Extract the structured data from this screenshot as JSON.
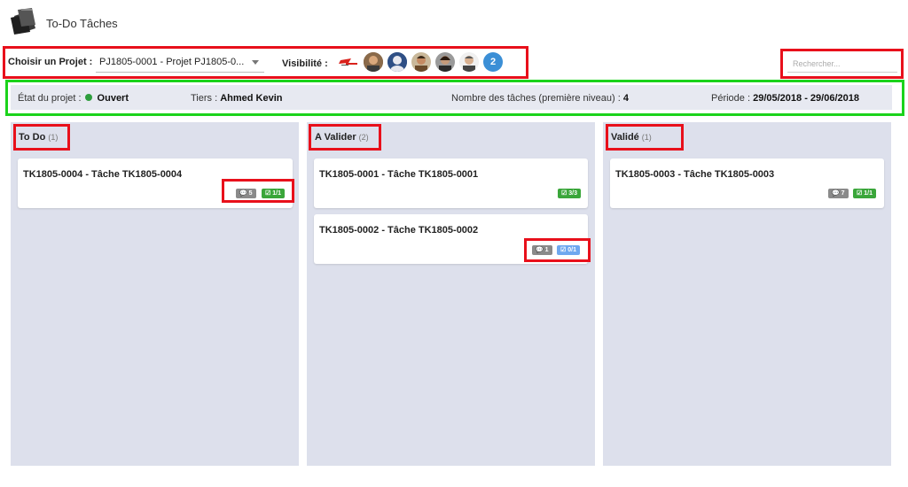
{
  "app": {
    "title": "To-Do Tâches",
    "logo_icon": "folders-icon"
  },
  "toolbar": {
    "project_label": "Choisir un Projet :",
    "project_value": "PJ1805-0001 - Projet PJ1805-0...",
    "visibility_label": "Visibilité :",
    "visibility_extra_count": "2",
    "search_placeholder": "Rechercher..."
  },
  "info": {
    "status_label": "État du projet :",
    "status_value": "Ouvert",
    "status_color": "#2e9d3d",
    "tiers_label": "Tiers :",
    "tiers_value": "Ahmed Kevin",
    "count_label": "Nombre des tâches (première niveau) :",
    "count_value": "4",
    "period_label": "Période :",
    "period_value": "29/05/2018 - 29/06/2018"
  },
  "columns": [
    {
      "title": "To Do",
      "count": "(1)",
      "cards": [
        {
          "title": "TK1805-0004 - Tâche TK1805-0004",
          "comments": "5",
          "checks": "1/1",
          "check_color": "green"
        }
      ]
    },
    {
      "title": "A Valider",
      "count": "(2)",
      "cards": [
        {
          "title": "TK1805-0001 - Tâche TK1805-0001",
          "comments": "",
          "checks": "3/3",
          "check_color": "green"
        },
        {
          "title": "TK1805-0002 - Tâche TK1805-0002",
          "comments": "1",
          "checks": "0/1",
          "check_color": "blue"
        }
      ]
    },
    {
      "title": "Validé",
      "count": "(1)",
      "cards": [
        {
          "title": "TK1805-0003 - Tâche TK1805-0003",
          "comments": "7",
          "checks": "1/1",
          "check_color": "green"
        }
      ]
    }
  ],
  "colors": {
    "highlight_red": "#e8101b",
    "highlight_green": "#1bd31b",
    "column_bg": "#dde0ec",
    "accent_blue": "#3b8fd6"
  }
}
